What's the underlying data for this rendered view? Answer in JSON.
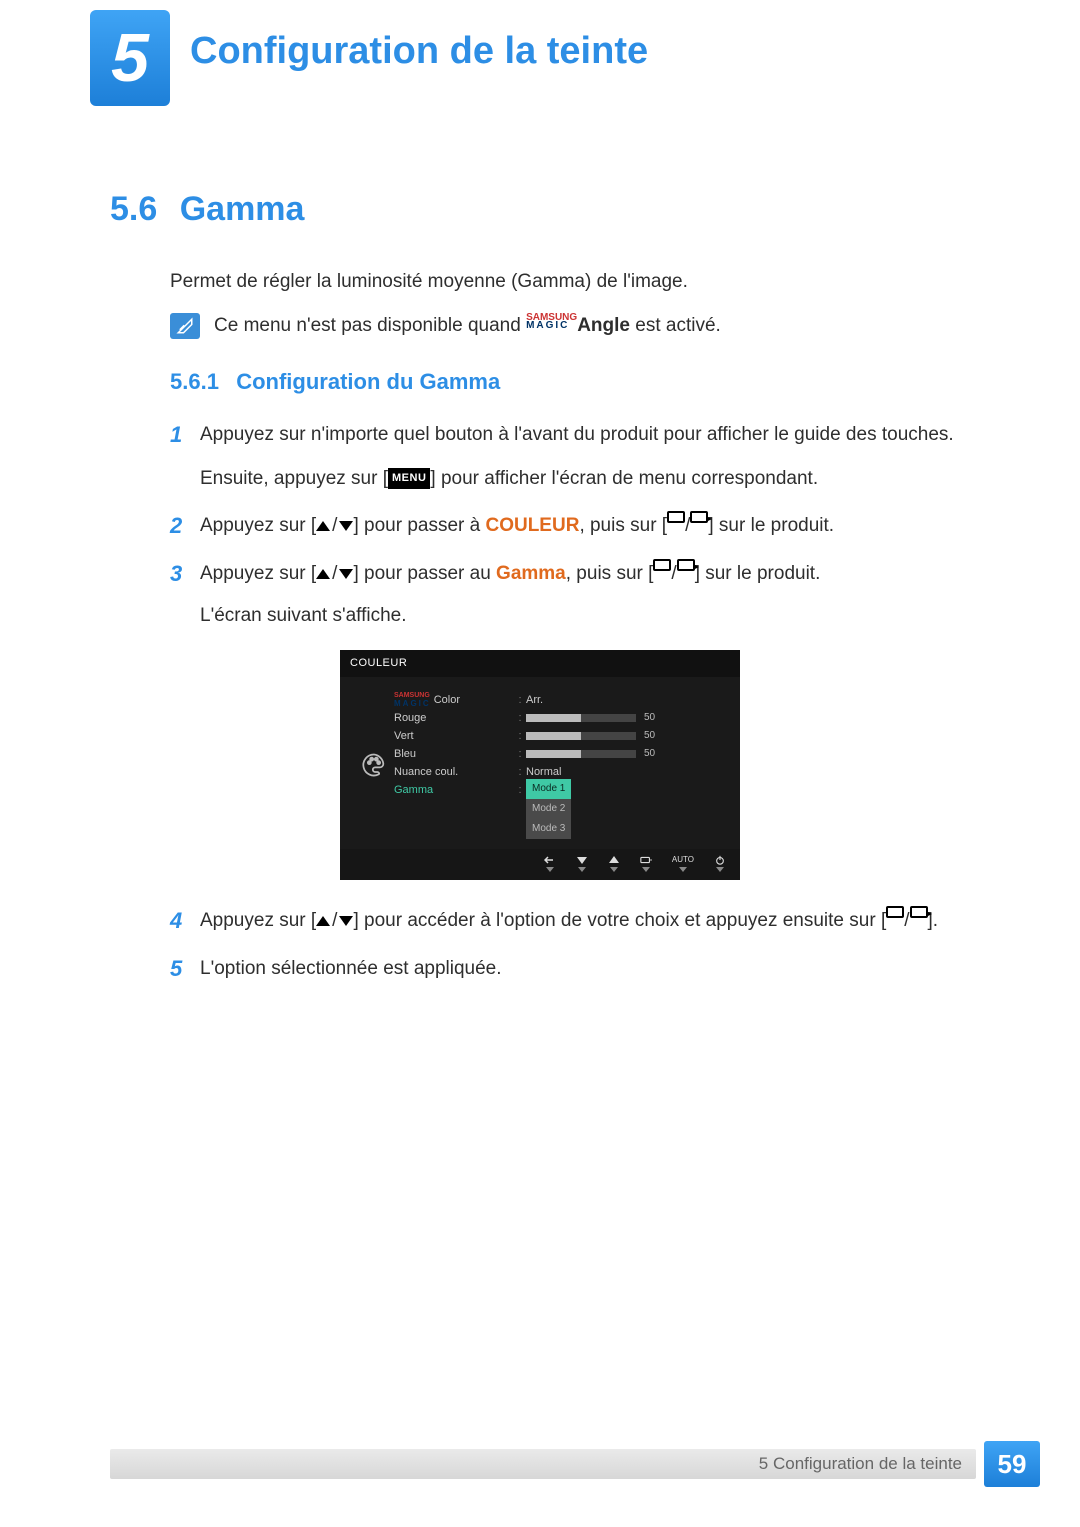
{
  "chapter": {
    "number": "5",
    "title": "Configuration de la teinte"
  },
  "section": {
    "number": "5.6",
    "title": "Gamma"
  },
  "intro": "Permet de régler la luminosité moyenne (Gamma) de l'image.",
  "note": {
    "before": "Ce menu n'est pas disponible quand ",
    "brand_top": "SAMSUNG",
    "brand_bot": "MAGIC",
    "feature": "Angle",
    "after": " est activé."
  },
  "subsection": {
    "number": "5.6.1",
    "title": "Configuration du Gamma"
  },
  "steps": {
    "s1a": "Appuyez sur n'importe quel bouton à l'avant du produit pour afficher le guide des touches.",
    "s1b_pre": "Ensuite, appuyez sur [",
    "s1b_menu": "MENU",
    "s1b_post": "] pour afficher l'écran de menu correspondant.",
    "s2_pre": "Appuyez sur [",
    "s2_mid": "] pour passer à ",
    "s2_target": "COULEUR",
    "s2_post1": ", puis sur [",
    "s2_post2": "] sur le produit.",
    "s3_pre": "Appuyez sur [",
    "s3_mid": "] pour passer au ",
    "s3_target": "Gamma",
    "s3_post1": ", puis sur [",
    "s3_post2": "] sur le produit.",
    "s3_line2": "L'écran suivant s'affiche.",
    "s4_pre": "Appuyez sur [",
    "s4_mid": "] pour accéder à l'option de votre choix et appuyez ensuite sur [",
    "s4_post": "].",
    "s5": "L'option sélectionnée est appliquée."
  },
  "osd": {
    "title": "COULEUR",
    "labels": {
      "magic": "Color",
      "rouge": "Rouge",
      "vert": "Vert",
      "bleu": "Bleu",
      "nuance": "Nuance coul.",
      "gamma": "Gamma"
    },
    "values": {
      "magic": "Arr.",
      "rouge": "50",
      "vert": "50",
      "bleu": "50",
      "nuance": "Normal",
      "mode1": "Mode 1",
      "mode2": "Mode 2",
      "mode3": "Mode 3"
    },
    "footer_auto": "AUTO"
  },
  "footer": {
    "text": "5 Configuration de la teinte",
    "page": "59"
  }
}
